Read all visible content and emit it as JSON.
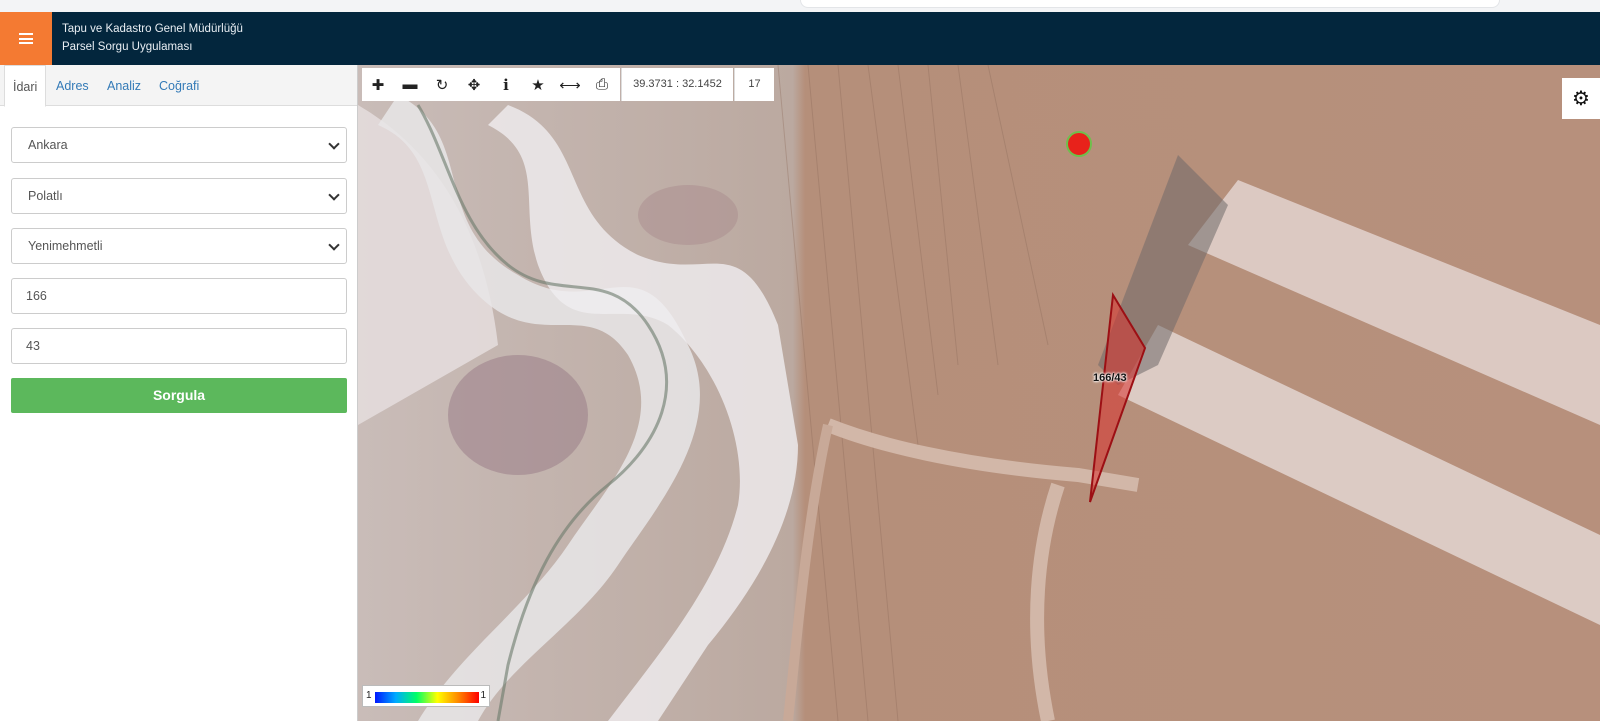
{
  "header": {
    "title_line1": "Tapu ve Kadastro Genel Müdürlüğü",
    "title_line2": "Parsel Sorgu Uygulaması"
  },
  "tabs": [
    {
      "label": "İdari",
      "active": true
    },
    {
      "label": "Adres",
      "active": false
    },
    {
      "label": "Analiz",
      "active": false
    },
    {
      "label": "Coğrafi",
      "active": false
    }
  ],
  "form": {
    "il": "Ankara",
    "ilce": "Polatlı",
    "mahalle": "Yenimehmetli",
    "ada": "166",
    "parsel": "43",
    "submit_label": "Sorgula"
  },
  "toolbar": {
    "tools": [
      "zoom-in-icon",
      "zoom-out-icon",
      "refresh-icon",
      "pan-icon",
      "info-icon",
      "favorite-icon",
      "measure-icon",
      "print-icon"
    ],
    "coordinates": "39.3731 : 32.1452",
    "zoom_level": "17"
  },
  "map": {
    "parcel_label": "166/43",
    "parcel_color": "#d9322e",
    "marker_color": "#e8221b"
  },
  "legend": {
    "min": "1",
    "max": "1"
  }
}
